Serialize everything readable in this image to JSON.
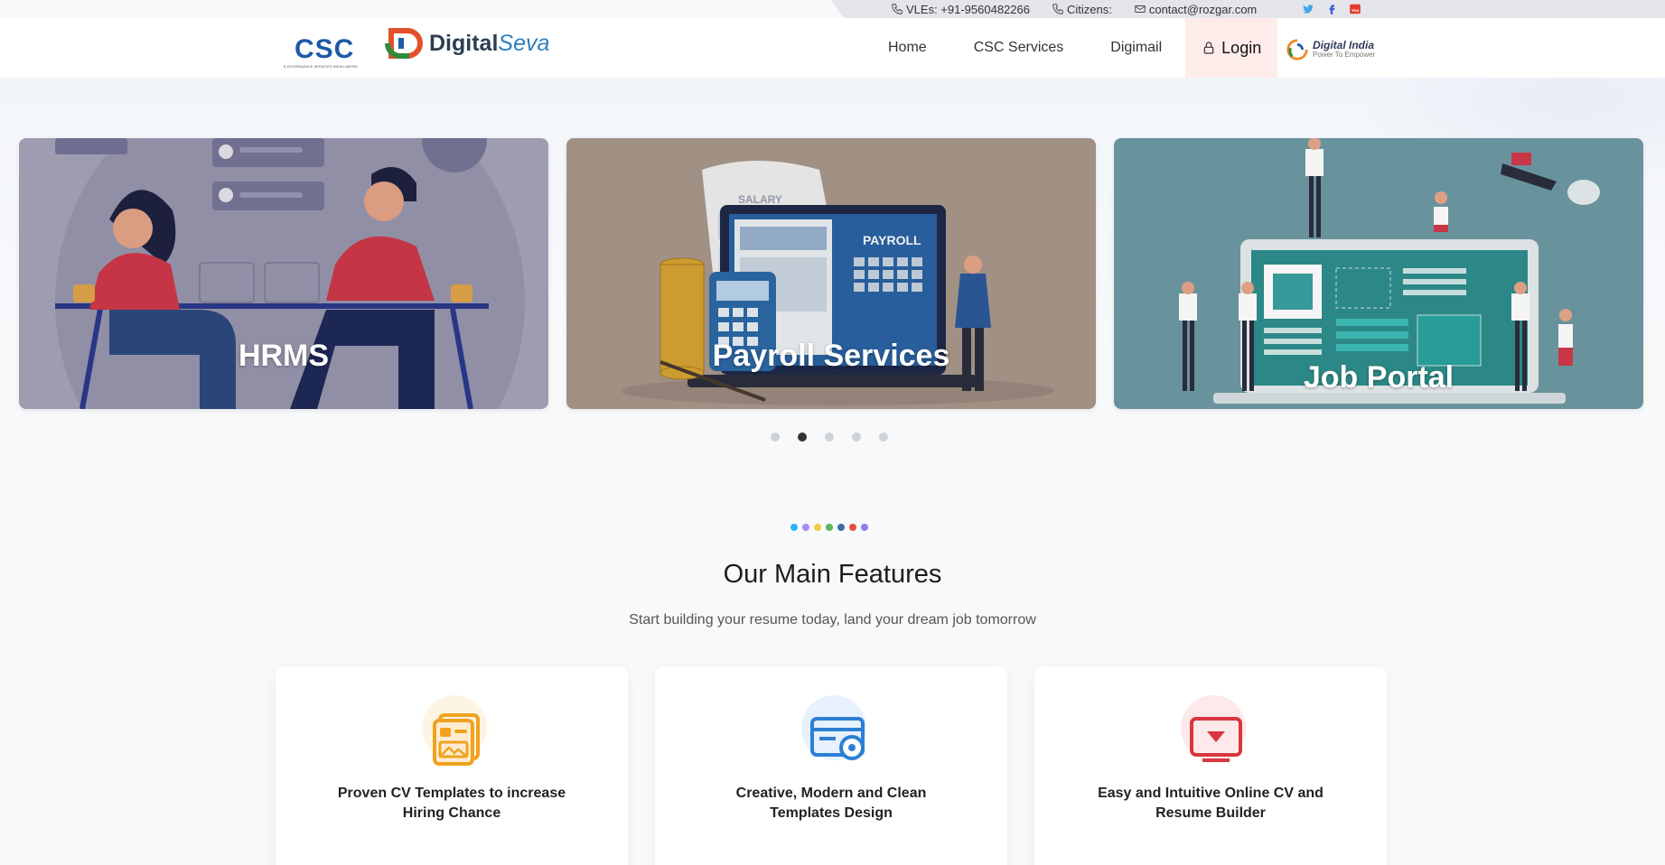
{
  "topbar": {
    "vles": "VLEs: +91-9560482266",
    "citizens": "Citizens:",
    "email": "contact@rozgar.com",
    "socials": [
      "twitter-icon",
      "facebook-icon",
      "youtube-icon"
    ]
  },
  "header": {
    "csc_logo": "CSC",
    "csc_logo_sub": "E-GOVERNANCE SERVICES INDIA LIMITED",
    "ds_logo_bold": "Digital",
    "ds_logo_italic": "Seva",
    "nav": [
      "Home",
      "CSC Services",
      "Digimail"
    ],
    "login": "Login",
    "di_title": "Digital India",
    "di_sub": "Power To Empower"
  },
  "carousel": {
    "slides": [
      {
        "title": "HRMS"
      },
      {
        "title": "Payroll Services",
        "art_labels": [
          "SALARY",
          "PAYROLL"
        ]
      },
      {
        "title": "Job Portal"
      }
    ],
    "dots": 5,
    "active_dot": 1
  },
  "features": {
    "title": "Our Main Features",
    "subtitle": "Start building your resume today, land your dream job tomorrow",
    "dot_colors": [
      "#2ab7f1",
      "#a78bfa",
      "#f7c948",
      "#5cb85c",
      "#3a6ea5",
      "#e84d3d",
      "#8e7cf2"
    ],
    "cards": [
      {
        "text": "Proven CV Templates to increase Hiring Chance",
        "icon": "cv-template-icon",
        "color": "#f0a21e"
      },
      {
        "text": "Creative, Modern and Clean Templates Design",
        "icon": "template-design-icon",
        "color": "#2d7fd3"
      },
      {
        "text": "Easy and Intuitive Online CV and Resume Builder",
        "icon": "resume-builder-icon",
        "color": "#d9363e"
      }
    ]
  }
}
